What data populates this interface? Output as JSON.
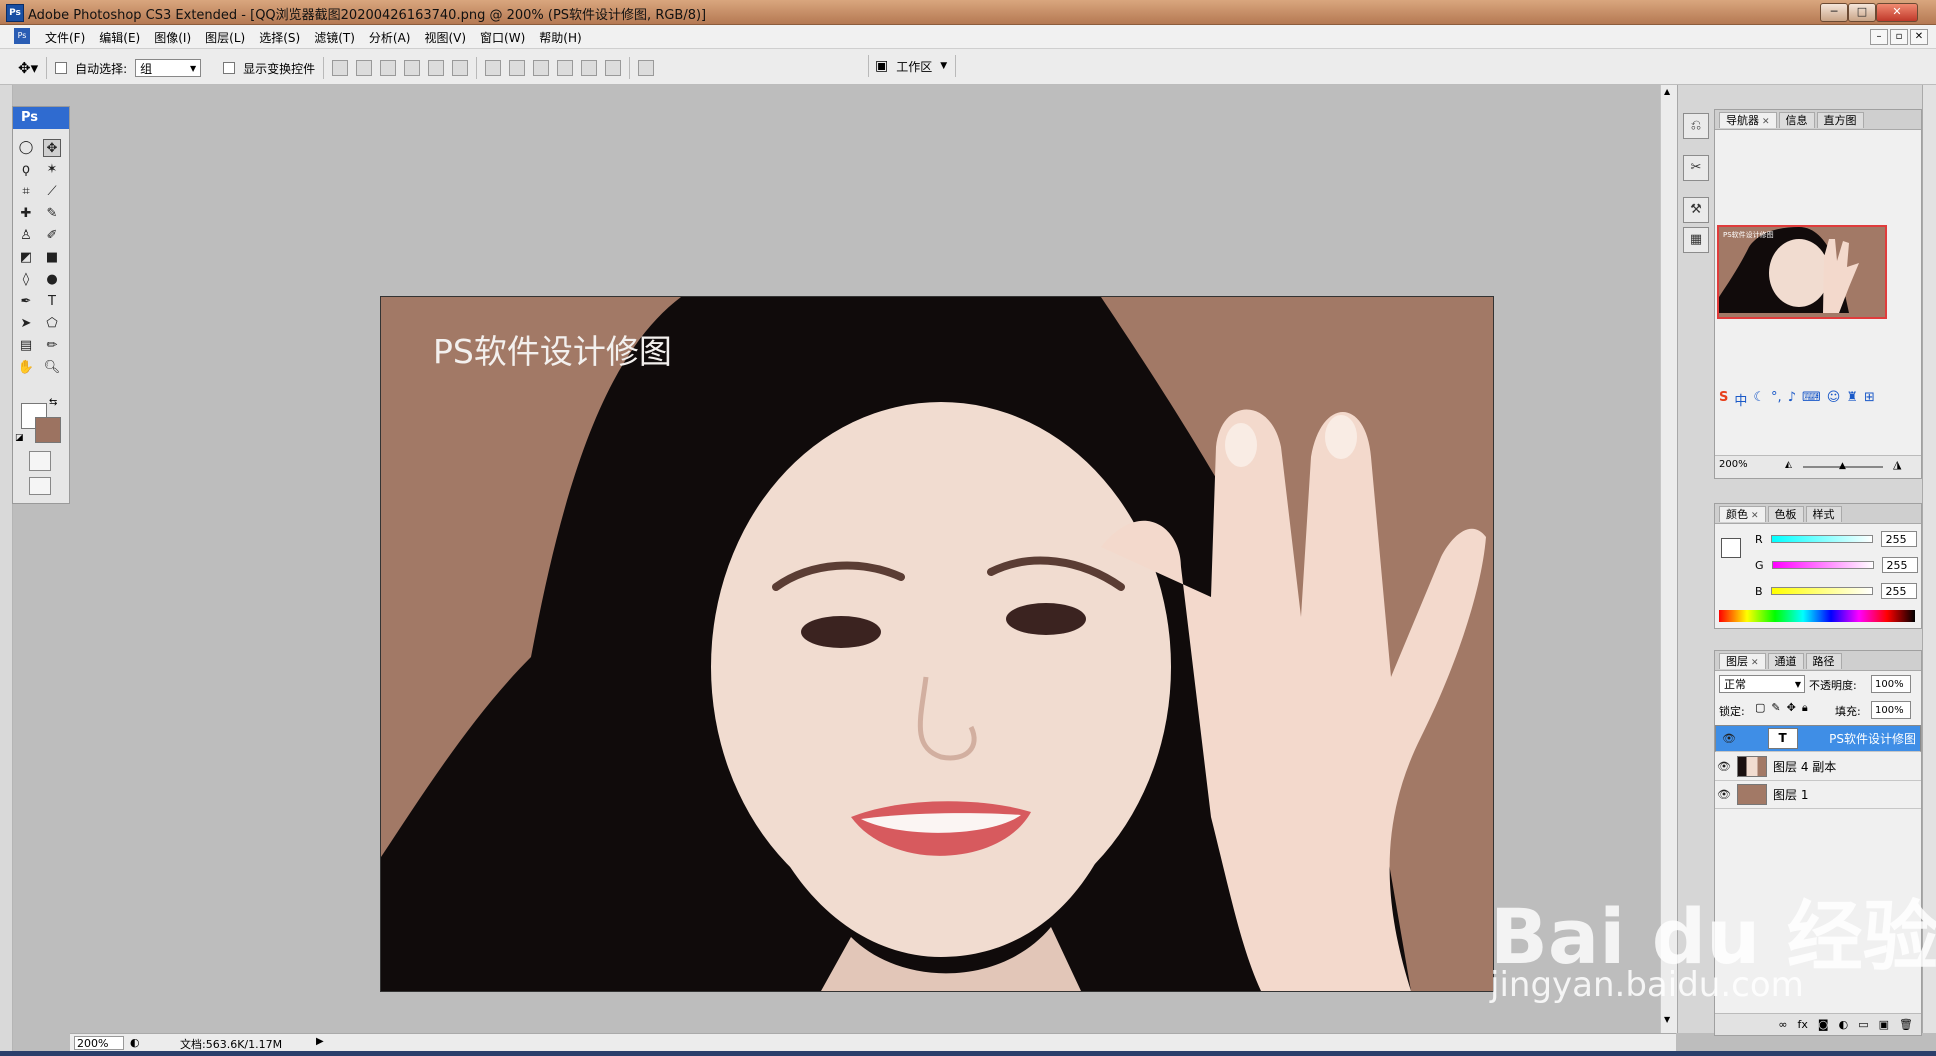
{
  "window": {
    "title": "Adobe Photoshop CS3 Extended - [QQ浏览器截图20200426163740.png @ 200% (PS软件设计修图, RGB/8)]",
    "app_badge": "Ps"
  },
  "menu": [
    "文件(F)",
    "编辑(E)",
    "图像(I)",
    "图层(L)",
    "选择(S)",
    "滤镜(T)",
    "分析(A)",
    "视图(V)",
    "窗口(W)",
    "帮助(H)"
  ],
  "options": {
    "auto_select_label": "自动选择:",
    "auto_select_value": "组",
    "show_transform_label": "显示变换控件",
    "workspace_label": "工作区"
  },
  "toolbox": {
    "head": "Ps",
    "fg_color": "#ffffff",
    "bg_color": "#9c7361"
  },
  "document": {
    "text_layer": "PS软件设计修图",
    "bg_color": "#a27966"
  },
  "status": {
    "zoom": "200%",
    "doc_info": "文档:563.6K/1.17M"
  },
  "navigator": {
    "tabs": [
      "导航器",
      "信息",
      "直方图"
    ],
    "thumb_text": "PS软件设计修图",
    "zoom": "200%"
  },
  "color_panel": {
    "tabs": [
      "颜色",
      "色板",
      "样式"
    ],
    "channels": [
      {
        "label": "R",
        "value": "255",
        "gradient": "linear-gradient(90deg,#00ffff,#ffffff)"
      },
      {
        "label": "G",
        "value": "255",
        "gradient": "linear-gradient(90deg,#ff00ff,#ffffff)"
      },
      {
        "label": "B",
        "value": "255",
        "gradient": "linear-gradient(90deg,#ffff00,#ffffff)"
      }
    ]
  },
  "layers_panel": {
    "tabs": [
      "图层",
      "通道",
      "路径"
    ],
    "blend_mode": "正常",
    "opacity_label": "不透明度:",
    "opacity_value": "100%",
    "lock_label": "锁定:",
    "fill_label": "填充:",
    "fill_value": "100%",
    "layers": [
      {
        "name": "PS软件设计修图",
        "type": "T",
        "selected": true
      },
      {
        "name": "图层 4 副本",
        "type": "image",
        "selected": false
      },
      {
        "name": "图层 1",
        "type": "fill",
        "selected": false
      }
    ]
  },
  "watermark": {
    "brand": "Bai du 经验",
    "url": "jingyan.baidu.com"
  }
}
